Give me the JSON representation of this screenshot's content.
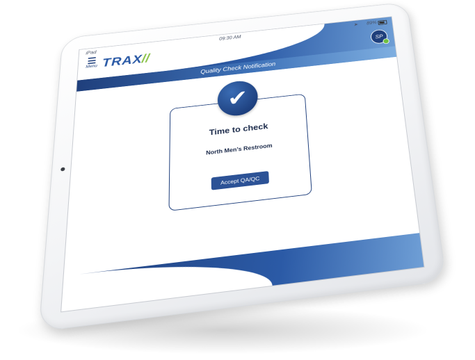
{
  "status_bar": {
    "carrier": "iPad",
    "time": "09:30 AM",
    "location_arrow": "➤",
    "battery_pct": "89%"
  },
  "header": {
    "menu_label": "Menu",
    "menu_icon": "☰",
    "logo_text": "TRAX",
    "logo_slashes": "//",
    "avatar_initials": "SP",
    "avatar_status_color": "#6fbf40"
  },
  "title_bar": {
    "title": "Quality Check Notification"
  },
  "card": {
    "check_icon": "✔",
    "heading": "Time to check",
    "location": "North Men’s Restroom",
    "accept_label": "Accept QA/QC"
  },
  "colors": {
    "primary": "#1f3f7c",
    "accent": "#2b5aa6",
    "light": "#7eaee0"
  }
}
